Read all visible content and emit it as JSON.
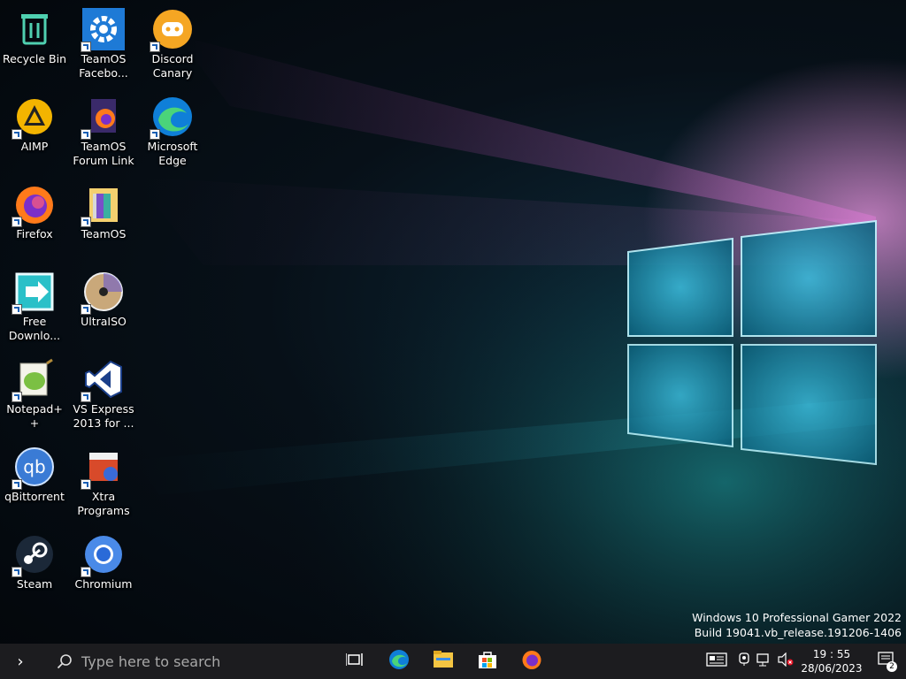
{
  "desktop": {
    "icons": [
      {
        "label": "Recycle Bin",
        "icon": "recycle-bin-icon"
      },
      {
        "label": "TeamOS Facebo...",
        "icon": "gear-icon"
      },
      {
        "label": "Discord Canary",
        "icon": "discord-icon"
      },
      {
        "label": "AIMP",
        "icon": "aimp-icon"
      },
      {
        "label": "TeamOS Forum Link",
        "icon": "firefox-doc-icon"
      },
      {
        "label": "Microsoft Edge",
        "icon": "edge-icon"
      },
      {
        "label": "Firefox",
        "icon": "firefox-icon"
      },
      {
        "label": "TeamOS",
        "icon": "folder-icon"
      },
      {
        "label": "Free Downlo...",
        "icon": "download-manager-icon"
      },
      {
        "label": "UltraISO",
        "icon": "disc-icon"
      },
      {
        "label": "Notepad++",
        "icon": "notepadpp-icon"
      },
      {
        "label": "VS Express 2013 for ...",
        "icon": "visual-studio-icon"
      },
      {
        "label": "qBittorrent",
        "icon": "qbittorrent-icon"
      },
      {
        "label": "Xtra Programs",
        "icon": "toolbox-icon"
      },
      {
        "label": "Steam",
        "icon": "steam-icon"
      },
      {
        "label": "Chromium",
        "icon": "chromium-icon"
      }
    ]
  },
  "watermark": {
    "line1": "Windows 10 Professional Gamer 2022",
    "line2": "Build 19041.vb_release.191206-1406"
  },
  "taskbar": {
    "search_placeholder": "Type here to search",
    "pinned": [
      "task-view-icon",
      "edge-icon",
      "file-explorer-icon",
      "store-icon",
      "firefox-icon"
    ],
    "clock": {
      "time": "19 : 55",
      "date": "28/06/2023"
    },
    "notifications_count": "2"
  },
  "colors": {
    "taskbar": "#1c1c1f",
    "accent": "#0078d4"
  }
}
